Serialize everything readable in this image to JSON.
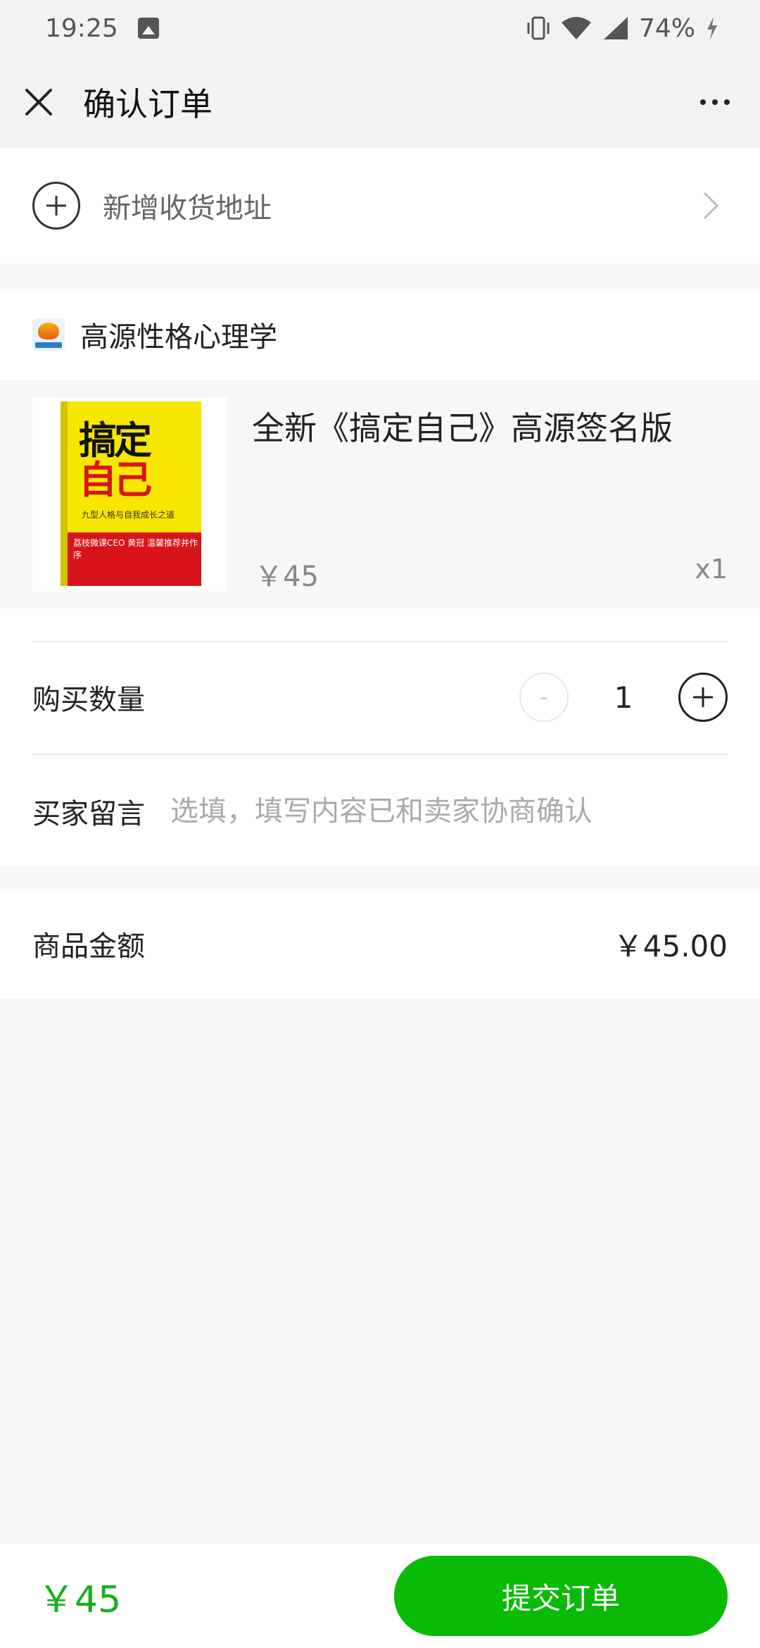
{
  "status_bar": {
    "time": "19:25",
    "battery": "74%",
    "icons": [
      "photo-icon",
      "vibrate-icon",
      "wifi-icon",
      "signal-icon",
      "charging-icon"
    ]
  },
  "nav": {
    "title": "确认订单",
    "close_icon": "close-icon",
    "more_icon": "more-icon"
  },
  "address": {
    "label": "新增收货地址"
  },
  "store": {
    "name": "高源性格心理学"
  },
  "product": {
    "title": "全新《搞定自己》高源签名版",
    "price": "￥45",
    "quantity": "x1",
    "cover": {
      "title_line1": "搞定",
      "title_line2": "自己",
      "subtitle": "九型人格与自我成长之道",
      "band_text": "荔枝微课CEO 黄冠 温馨推荐并作序"
    }
  },
  "purchase": {
    "quantity_label": "购买数量",
    "quantity_value": "1",
    "minus": "-",
    "plus": "+"
  },
  "message": {
    "label": "买家留言",
    "placeholder": "选填，填写内容已和卖家协商确认"
  },
  "amount": {
    "label": "商品金额",
    "value": "￥45.00"
  },
  "footer": {
    "total": "￥45",
    "submit_label": "提交订单"
  },
  "colors": {
    "accent_green": "#09bb07",
    "price_green": "#1aad19",
    "background": "#f7f7f8"
  }
}
